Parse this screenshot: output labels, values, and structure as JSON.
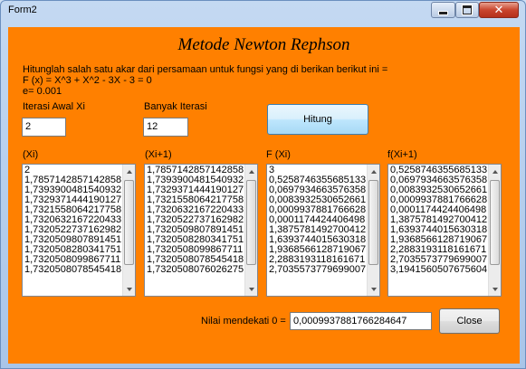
{
  "window": {
    "title": "Form2"
  },
  "form": {
    "heading": "Metode Newton Rephson",
    "description": [
      "Hitunglah salah satu akar dari persamaan untuk fungsi yang di berikan berikut ini =",
      "F (x) = X^3 + X^2 - 3X - 3 = 0",
      "e= 0.001"
    ],
    "iterasi_awal": {
      "label": "Iterasi Awal Xi",
      "value": "2"
    },
    "banyak_iterasi": {
      "label": "Banyak Iterasi",
      "value": "12"
    },
    "hitung_label": "Hitung",
    "result_label": "Nilai mendekati 0 =",
    "result_value": "0,0009937881766284647",
    "close_label": "Close"
  },
  "lists": [
    {
      "header": "(Xi)",
      "items": [
        "2",
        "1,7857142857142858",
        "1,7393900481540932",
        "1,7329371444190127",
        "1,7321558064217758",
        "1,7320632167220433",
        "1,7320522737162982",
        "1,7320509807891451",
        "1,7320508280341751",
        "1,7320508099867711",
        "1,7320508078545418"
      ]
    },
    {
      "header": "(Xi+1)",
      "items": [
        "1,7857142857142858",
        "1,7393900481540932",
        "1,7329371444190127",
        "1,7321558064217758",
        "1,7320632167220433",
        "1,7320522737162982",
        "1,7320509807891451",
        "1,7320508280341751",
        "1,7320508099867711",
        "1,7320508078545418",
        "1,7320508076026275"
      ]
    },
    {
      "header": "F (Xi)",
      "items": [
        "3",
        "0,5258746355685133",
        "0,0697934663576358",
        "0,0083932530652661",
        "0,0009937881766628",
        "0,0001174424406498",
        "1,3875781492700412",
        "1,6393744015630318",
        "1,9368566128719067",
        "2,2883193118161671",
        "2,7035573779699007"
      ]
    },
    {
      "header": "f(Xi+1)",
      "items": [
        "0,5258746355685133",
        "0,0697934663576358",
        "0,0083932530652661",
        "0,0009937881766628",
        "0,0001174424406498",
        "1,3875781492700412",
        "1,6393744015630318",
        "1,9368566128719067",
        "2,2883193118161671",
        "2,7035573779699007",
        "3,1941560507675604"
      ]
    }
  ],
  "colors": {
    "form_background": "#ff8000"
  }
}
